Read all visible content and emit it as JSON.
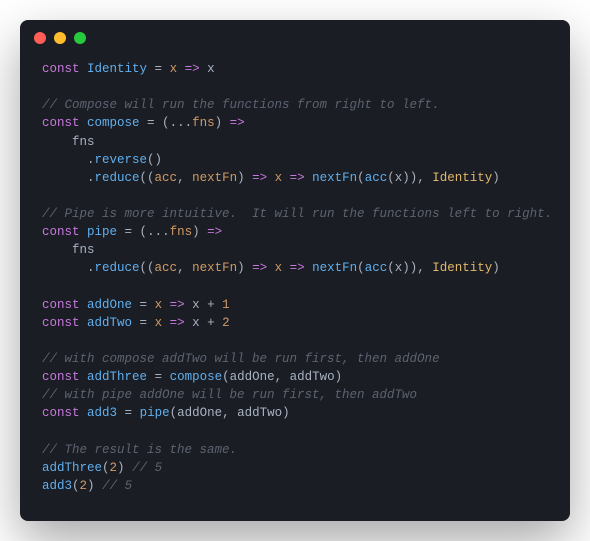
{
  "colors": {
    "bg": "#1a1d23",
    "keyword": "#c778dd",
    "function": "#61afef",
    "identifier": "#e2b86b",
    "param": "#d19a66",
    "comment": "#5c6370",
    "number": "#d19a66"
  },
  "code": {
    "l1_const": "const",
    "l1_name": "Identity",
    "l1_eq": " = ",
    "l1_x": "x",
    "l1_arrow": " => ",
    "l1_x2": "x",
    "l3_comment": "// Compose will run the functions from right to left.",
    "l4_const": "const",
    "l4_name": "compose",
    "l4_eq": " = (",
    "l4_spread": "...",
    "l4_fns": "fns",
    "l4_close": ")",
    "l4_arrow": " =>",
    "l5_fns": "    fns",
    "l6_indent": "      .",
    "l6_reverse": "reverse",
    "l6_paren": "()",
    "l7_indent": "      .",
    "l7_reduce": "reduce",
    "l7_open": "((",
    "l7_acc": "acc",
    "l7_c1": ", ",
    "l7_nextfn": "nextFn",
    "l7_close1": ")",
    "l7_arrow1": " => ",
    "l7_x": "x",
    "l7_arrow2": " => ",
    "l7_nextfn2": "nextFn",
    "l7_open2": "(",
    "l7_acc2": "acc",
    "l7_open3": "(",
    "l7_x2": "x",
    "l7_close2": ")), ",
    "l7_identity": "Identity",
    "l7_close3": ")",
    "l9_comment": "// Pipe is more intuitive.  It will run the functions left to right.",
    "l10_const": "const",
    "l10_name": "pipe",
    "l10_eq": " = (",
    "l10_spread": "...",
    "l10_fns": "fns",
    "l10_close": ")",
    "l10_arrow": " =>",
    "l11_fns": "    fns",
    "l12_indent": "      .",
    "l12_reduce": "reduce",
    "l12_open": "((",
    "l12_acc": "acc",
    "l12_c1": ", ",
    "l12_nextfn": "nextFn",
    "l12_close1": ")",
    "l12_arrow1": " => ",
    "l12_x": "x",
    "l12_arrow2": " => ",
    "l12_nextfn2": "nextFn",
    "l12_open2": "(",
    "l12_acc2": "acc",
    "l12_open3": "(",
    "l12_x2": "x",
    "l12_close2": ")), ",
    "l12_identity": "Identity",
    "l12_close3": ")",
    "l14_const": "const",
    "l14_name": "addOne",
    "l14_eq": " = ",
    "l14_x": "x",
    "l14_arrow": " => ",
    "l14_x2": "x",
    "l14_plus": " + ",
    "l14_num": "1",
    "l15_const": "const",
    "l15_name": "addTwo",
    "l15_eq": " = ",
    "l15_x": "x",
    "l15_arrow": " => ",
    "l15_x2": "x",
    "l15_plus": " + ",
    "l15_num": "2",
    "l17_comment": "// with compose addTwo will be run first, then addOne",
    "l18_const": "const",
    "l18_name": "addThree",
    "l18_eq": " = ",
    "l18_compose": "compose",
    "l18_open": "(",
    "l18_a1": "addOne",
    "l18_c": ", ",
    "l18_a2": "addTwo",
    "l18_close": ")",
    "l19_comment": "// with pipe addOne will be run first, then addTwo",
    "l20_const": "const",
    "l20_name": "add3",
    "l20_eq": " = ",
    "l20_pipe": "pipe",
    "l20_open": "(",
    "l20_a1": "addOne",
    "l20_c": ", ",
    "l20_a2": "addTwo",
    "l20_close": ")",
    "l22_comment": "// The result is the same.",
    "l23_fn": "addThree",
    "l23_open": "(",
    "l23_num": "2",
    "l23_close": ")",
    "l23_comment": " // 5",
    "l24_fn": "add3",
    "l24_open": "(",
    "l24_num": "2",
    "l24_close": ")",
    "l24_comment": " // 5"
  }
}
